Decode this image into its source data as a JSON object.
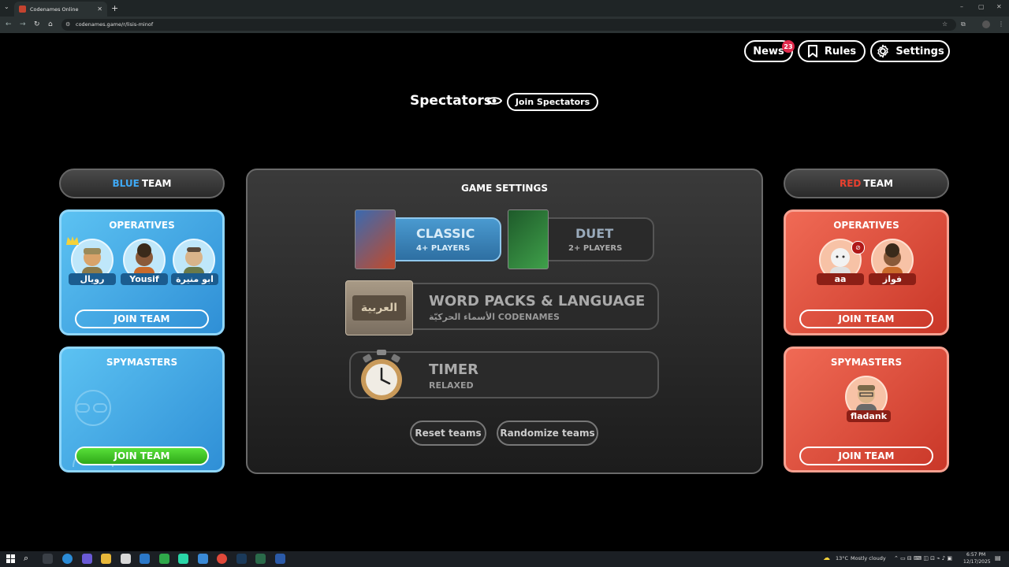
{
  "browser": {
    "tab_title": "Codenames Online",
    "tab_close": "✕",
    "new_tab": "+",
    "url": "codenames.game/r/lisis-minof",
    "controls": {
      "minimize": "–",
      "maximize": "▢",
      "close": "✕"
    }
  },
  "topnav": {
    "news_label": "News",
    "news_badge": "23",
    "rules_label": "Rules",
    "settings_label": "Settings"
  },
  "spectators": {
    "title": "Spectators",
    "join_label": "Join Spectators"
  },
  "blue_team": {
    "header_color_word": "BLUE",
    "header_word": "TEAM",
    "operatives_title": "OPERATIVES",
    "operatives": [
      {
        "name": "رويال"
      },
      {
        "name": "Yousif"
      },
      {
        "name": "ابو منيرة"
      }
    ],
    "join_operatives": "JOIN TEAM",
    "spymasters_title": "SPYMASTERS",
    "join_spymasters": "JOIN TEAM"
  },
  "red_team": {
    "header_color_word": "RED",
    "header_word": "TEAM",
    "operatives_title": "OPERATIVES",
    "operatives": [
      {
        "name": "aa"
      },
      {
        "name": "فواز"
      }
    ],
    "join_operatives": "JOIN TEAM",
    "spymasters_title": "SPYMASTERS",
    "spymasters": [
      {
        "name": "fladank"
      }
    ],
    "join_spymasters": "JOIN TEAM"
  },
  "game_settings": {
    "title": "GAME SETTINGS",
    "modes": [
      {
        "name": "CLASSIC",
        "players": "4+ PLAYERS",
        "selected": true
      },
      {
        "name": "DUET",
        "players": "2+ PLAYERS",
        "selected": false
      }
    ],
    "word_packs": {
      "title": "WORD PACKS & LANGUAGE",
      "subtitle": "الأسماء الحركيّة CODENAMES",
      "language_tag": "العربية"
    },
    "timer": {
      "title": "TIMER",
      "subtitle": "RELAXED"
    },
    "reset_label": "Reset teams",
    "randomize_label": "Randomize teams"
  },
  "taskbar": {
    "weather": "13°C",
    "weather_desc": "Mostly cloudy",
    "time": "6:57 PM",
    "date": "12/17/2025"
  },
  "colors": {
    "blue_accent": "#3fa9f5",
    "red_accent": "#e8402f",
    "badge": "#e0294b",
    "green_button": "#3fc522"
  }
}
